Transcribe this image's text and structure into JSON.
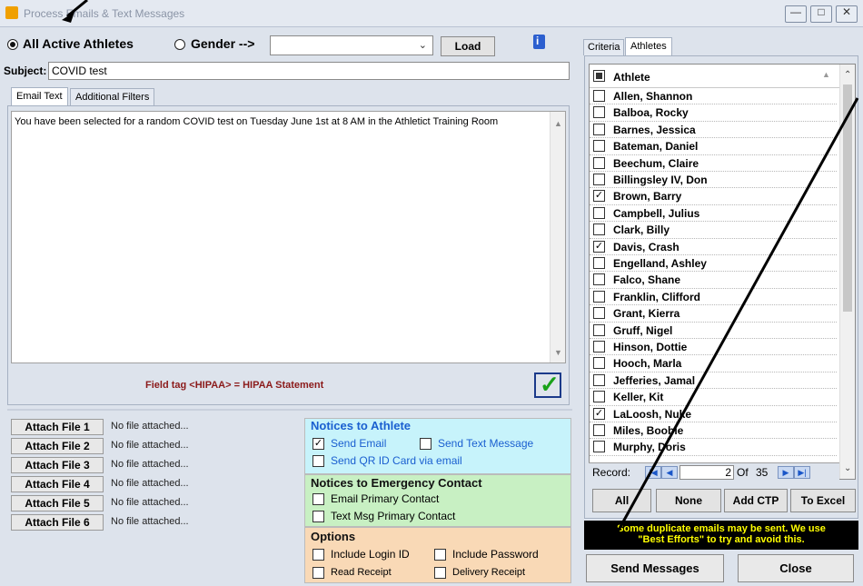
{
  "window": {
    "title": "Process Emails & Text Messages",
    "controls": [
      "minimize",
      "maximize",
      "close"
    ]
  },
  "filters": {
    "all_active_label": "All Active Athletes",
    "gender_label": "Gender -->",
    "gender_value": "",
    "load_label": "Load",
    "selected": "all_active"
  },
  "subject": {
    "label": "Subject:",
    "value": "COVID test"
  },
  "email_tabs": [
    "Email Text",
    "Additional Filters"
  ],
  "email_body": "You have been selected for a random COVID test on Tuesday June 1st at 8 AM in the Athletict Training Room",
  "field_tag_note": "Field tag <HIPAA> = HIPAA Statement",
  "attachments": [
    {
      "label": "Attach File 1",
      "status": "No file attached..."
    },
    {
      "label": "Attach File 2",
      "status": "No file attached..."
    },
    {
      "label": "Attach File 3",
      "status": "No file attached..."
    },
    {
      "label": "Attach File 4",
      "status": "No file attached..."
    },
    {
      "label": "Attach File 5",
      "status": "No file attached..."
    },
    {
      "label": "Attach File 6",
      "status": "No file attached..."
    }
  ],
  "notices_athlete": {
    "title": "Notices to Athlete",
    "send_email": {
      "label": "Send Email",
      "checked": true
    },
    "send_text": {
      "label": "Send Text Message",
      "checked": false
    },
    "send_qr": {
      "label": "Send QR ID Card via email",
      "checked": false
    },
    "bg": "#c7f3fb",
    "title_color": "#1a5fd0"
  },
  "notices_emergency": {
    "title": "Notices to Emergency Contact",
    "email_primary": {
      "label": "Email Primary Contact",
      "checked": false
    },
    "text_primary": {
      "label": "Text Msg Primary Contact",
      "checked": false
    },
    "bg": "#c8f0c3"
  },
  "options": {
    "title": "Options",
    "include_login": {
      "label": "Include Login ID",
      "checked": false
    },
    "include_password": {
      "label": "Include Password",
      "checked": false
    },
    "read_receipt": {
      "label": "Read Receipt",
      "checked": false
    },
    "delivery_receipt": {
      "label": "Delivery Receipt",
      "checked": false
    },
    "bg": "#f9d9b6"
  },
  "right_tabs": [
    "Criteria",
    "Athletes"
  ],
  "athletes_header": "Athlete",
  "athletes": [
    {
      "name": "Allen, Shannon",
      "checked": false
    },
    {
      "name": "Balboa, Rocky",
      "checked": false
    },
    {
      "name": "Barnes, Jessica",
      "checked": false
    },
    {
      "name": "Bateman, Daniel",
      "checked": false
    },
    {
      "name": "Beechum, Claire",
      "checked": false
    },
    {
      "name": "Billingsley IV, Don",
      "checked": false
    },
    {
      "name": "Brown, Barry",
      "checked": true
    },
    {
      "name": "Campbell, Julius",
      "checked": false
    },
    {
      "name": "Clark, Billy",
      "checked": false
    },
    {
      "name": "Davis, Crash",
      "checked": true
    },
    {
      "name": "Engelland, Ashley",
      "checked": false
    },
    {
      "name": "Falco, Shane",
      "checked": false
    },
    {
      "name": "Franklin, Clifford",
      "checked": false
    },
    {
      "name": "Grant, Kierra",
      "checked": false
    },
    {
      "name": "Gruff, Nigel",
      "checked": false
    },
    {
      "name": "Hinson, Dottie",
      "checked": false
    },
    {
      "name": "Hooch, Marla",
      "checked": false
    },
    {
      "name": "Jefferies, Jamal",
      "checked": false
    },
    {
      "name": "Keller, Kit",
      "checked": false
    },
    {
      "name": "LaLoosh, Nuke",
      "checked": true
    },
    {
      "name": "Miles, Boobie",
      "checked": false
    },
    {
      "name": "Murphy, Doris",
      "checked": false
    }
  ],
  "record_nav": {
    "label": "Record:",
    "current": "2",
    "of_label": "Of",
    "total": "35"
  },
  "list_buttons": {
    "all": "All",
    "none": "None",
    "add_ctp": "Add CTP",
    "to_excel": "To Excel"
  },
  "warning": {
    "text_line1": "Some duplicate emails may be sent.  We use",
    "text_line2": "\"Best Efforts\" to try and avoid this.",
    "bg": "#000000",
    "color": "#ffff00"
  },
  "actions": {
    "send": "Send Messages",
    "close": "Close"
  }
}
